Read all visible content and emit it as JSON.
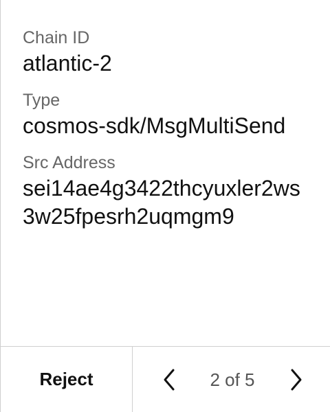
{
  "fields": [
    {
      "label": "Chain ID",
      "value": "atlantic-2"
    },
    {
      "label": "Type",
      "value": "cosmos-sdk/MsgMultiSend"
    },
    {
      "label": "Src Address",
      "value": "sei14ae4g3422thcyuxler2ws3w25fpesrh2uqmgm9"
    }
  ],
  "footer": {
    "reject_label": "Reject",
    "page_indicator": "2 of 5",
    "prev_icon": "chevron-left-icon",
    "next_icon": "chevron-right-icon"
  },
  "colors": {
    "text_primary": "#111111",
    "text_secondary": "#666666",
    "border": "#cfcfcf",
    "background": "#ffffff"
  }
}
